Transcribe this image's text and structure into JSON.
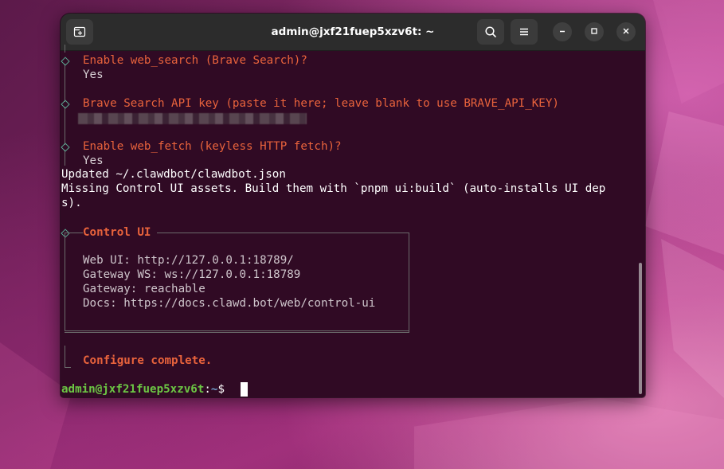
{
  "window": {
    "title": "admin@jxf21fuep5xzv6t: ~"
  },
  "icons": {
    "new_tab": "new-tab-icon",
    "search": "search-icon",
    "menu": "hamburger-menu-icon",
    "minimize": "minimize-icon",
    "maximize": "maximize-icon",
    "close": "close-icon"
  },
  "terminal": {
    "prompt_web_search": "Enable web_search (Brave Search)?",
    "answer_web_search": "Yes",
    "prompt_brave_key": "Brave Search API key (paste it here; leave blank to use BRAVE_API_KEY)",
    "prompt_web_fetch": "Enable web_fetch (keyless HTTP fetch)?",
    "answer_web_fetch": "Yes",
    "updated_line": "Updated ~/.clawdbot/clawdbot.json",
    "missing_line_1": "Missing Control UI assets. Build them with `pnpm ui:build` (auto-installs UI dep",
    "missing_line_2": "s).",
    "box_title": "Control UI",
    "web_ui": "Web UI: http://127.0.0.1:18789/",
    "gateway_ws": "Gateway WS: ws://127.0.0.1:18789",
    "gateway_status": "Gateway: reachable",
    "docs": "Docs: https://docs.clawd.bot/web/control-ui",
    "complete": "Configure complete.",
    "prompt_user": "admin@jxf21fuep5xzv6t",
    "prompt_sep": ":",
    "prompt_path": "~",
    "prompt_symbol": "$"
  },
  "colors": {
    "terminal_bg": "#300a24",
    "accent_orange": "#e9633c",
    "prompt_green": "#6cc644",
    "prompt_blue": "#729fcf",
    "diamond": "#5aa690"
  }
}
